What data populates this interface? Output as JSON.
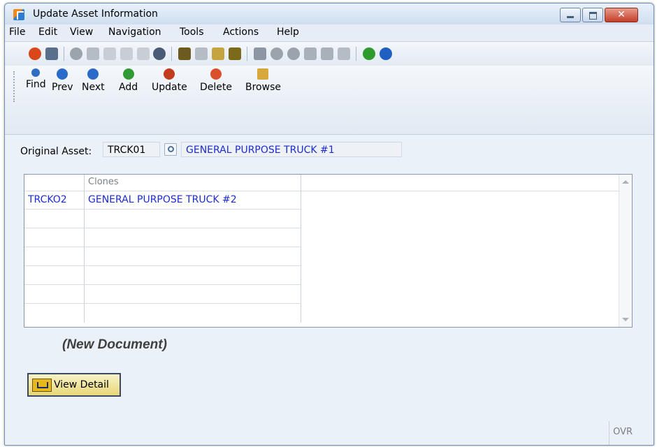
{
  "window": {
    "title": "Update Asset Information"
  },
  "menu": [
    "File",
    "Edit",
    "View",
    "Navigation",
    "Tools",
    "Actions",
    "Help"
  ],
  "nav_toolbar": [
    {
      "label": "Find",
      "icon": "magnifier-icon"
    },
    {
      "label": "Prev",
      "icon": "arrow-left-icon"
    },
    {
      "label": "Next",
      "icon": "arrow-right-icon"
    },
    {
      "label": "Add",
      "icon": "plus-icon"
    },
    {
      "label": "Update",
      "icon": "update-icon"
    },
    {
      "label": "Delete",
      "icon": "delete-icon"
    },
    {
      "label": "Browse",
      "icon": "browse-folder-icon"
    }
  ],
  "form": {
    "original_asset_label": "Original Asset:",
    "original_asset_code": "TRCK01",
    "original_asset_description": "GENERAL PURPOSE TRUCK #1"
  },
  "clones_table": {
    "header": {
      "col1": "",
      "col2": "Clones"
    },
    "rows": [
      {
        "code": "TRCKO2",
        "description": "GENERAL PURPOSE TRUCK #2"
      }
    ]
  },
  "status_text": "(New Document)",
  "view_detail_label": "View Detail",
  "status_bar": {
    "ovr": "OVR"
  },
  "colors": {
    "link_blue": "#1c2bd1",
    "window_bg": "#ebf1f8"
  }
}
